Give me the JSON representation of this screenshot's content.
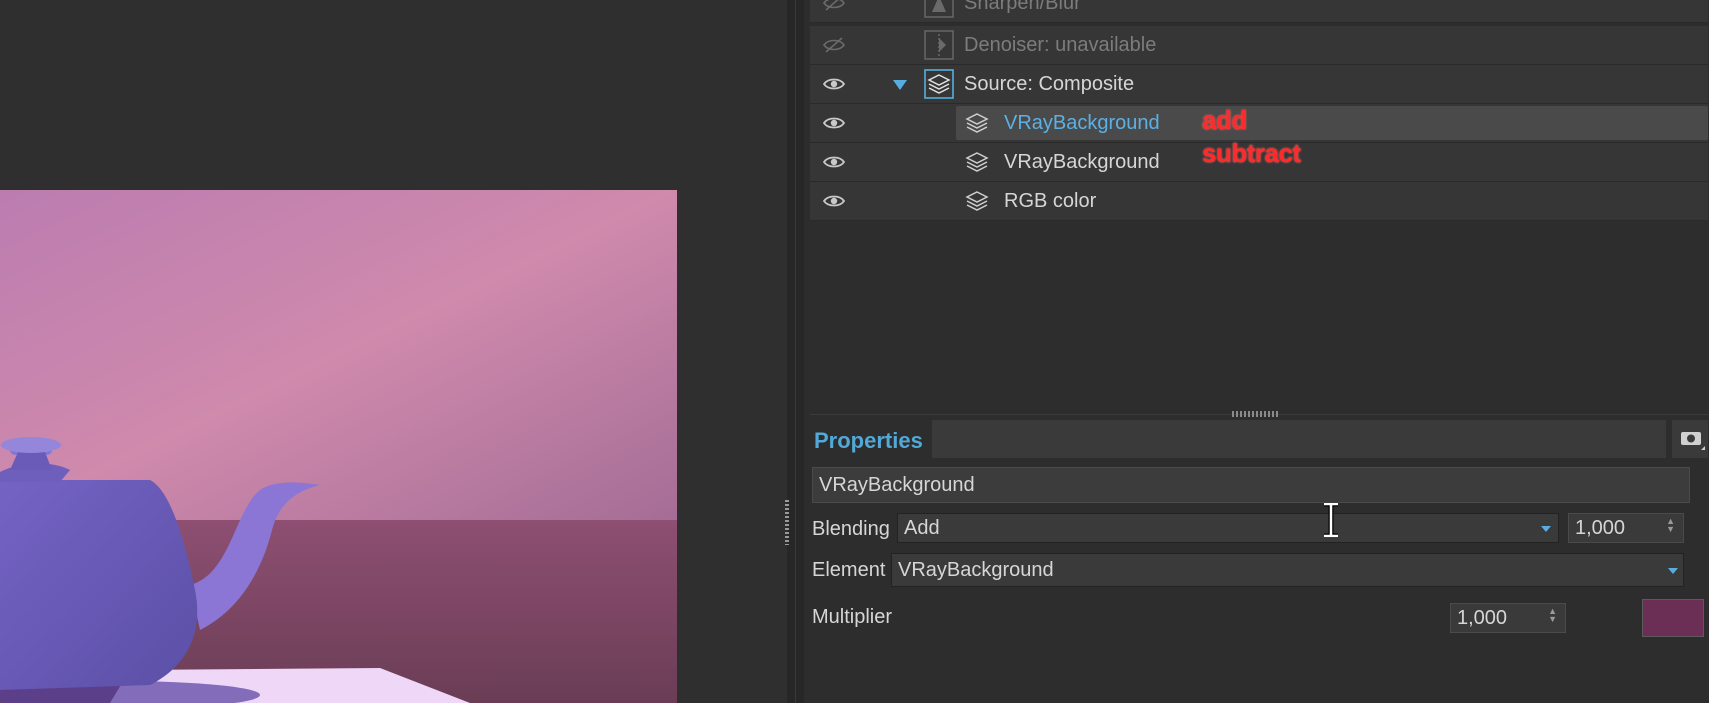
{
  "layers": {
    "rows": [
      {
        "label": "Sharpen/Blur",
        "visible": false
      },
      {
        "label": "Denoiser: unavailable",
        "visible": false
      },
      {
        "label": "Source: Composite",
        "visible": true,
        "expanded": true
      },
      {
        "label": "VRayBackground",
        "visible": true,
        "selected": true,
        "annotation": "add"
      },
      {
        "label": "VRayBackground",
        "visible": true,
        "annotation": "subtract"
      },
      {
        "label": "RGB color",
        "visible": true
      }
    ]
  },
  "properties": {
    "title": "Properties",
    "name_value": "VRayBackground",
    "blending_label": "Blending",
    "blending_value": "Add",
    "blending_amount": "1,000",
    "element_label": "Element",
    "element_value": "VRayBackground",
    "multiplier_label": "Multiplier",
    "multiplier_value": "1,000",
    "multiplier_color": "#6b2f55"
  },
  "colors": {
    "accent": "#52a8d6",
    "annotation": "#ff2a2a",
    "selected_label": "#5db0e4"
  }
}
